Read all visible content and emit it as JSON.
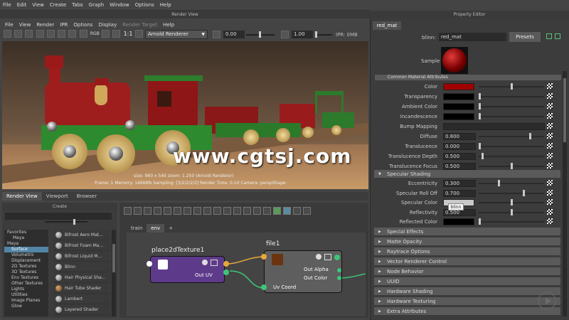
{
  "main_menu": [
    "File",
    "Edit",
    "View",
    "Create",
    "Tabs",
    "Graph",
    "Window",
    "Options",
    "Help"
  ],
  "render_view": {
    "title": "Render View",
    "menu": [
      "File",
      "View",
      "Render",
      "IPR",
      "Options",
      "Display",
      "Render Target",
      "Help"
    ],
    "renderer": "Arnold Renderer",
    "exposure": "0.00",
    "gamma": "1.00",
    "ipr": "IPR: 0MB",
    "ratio": "1:1",
    "mode": "RGB",
    "watermark": "www.cgtsj.com",
    "status_line1": "size: 960 x 540  zoom: 1.250     (Arnold Renderer)",
    "status_line2": "Frame: 1   Memory: 1466Mb   Sampling: [3/2/2/2/2]   Render Time: 0:10   Camera: perspShape"
  },
  "bottom_tabs": [
    "Render View",
    "Viewport",
    "Browser"
  ],
  "create_panel": {
    "title": "Create",
    "tree": [
      "Favorites",
      "Maya",
      "Maya",
      "Surface",
      "Volumetric",
      "Displacement",
      "2D Textures",
      "3D Textures",
      "Env Textures",
      "Other Textures",
      "Lights",
      "Utilities",
      "Image Planes",
      "Glow"
    ],
    "selected": "Surface",
    "shaders": [
      "Bifrost Aero Mat...",
      "Bifrost Foam Ma...",
      "Bifrost Liquid M...",
      "Blinn",
      "Hair Physical Sha...",
      "Hair Tube Shader",
      "Lambert",
      "Layered Shader"
    ]
  },
  "node_editor": {
    "tabs": [
      "train",
      "env",
      "+"
    ],
    "node1": {
      "title": "place2dTexture1",
      "port": "Out UV"
    },
    "node2": {
      "title": "file1",
      "ports": [
        "Out Alpha",
        "Out Color",
        "Uv Coord"
      ]
    }
  },
  "property_editor": {
    "title": "Property Editor",
    "tab": "red_mat",
    "type_label": "blinn:",
    "name": "red_mat",
    "presets": "Presets",
    "sample": "Sample",
    "common_section": "Common Material Attributes",
    "rows": [
      {
        "label": "Color",
        "kind": "color",
        "color": "#a00000",
        "knob": 0.5
      },
      {
        "label": "Transparency",
        "kind": "color",
        "color": "#000000",
        "knob": 0.0
      },
      {
        "label": "Ambient Color",
        "kind": "color",
        "color": "#000000",
        "knob": 0.0
      },
      {
        "label": "Incandescence",
        "kind": "color",
        "color": "#000000",
        "knob": 0.0
      },
      {
        "label": "Bump Mapping",
        "kind": "empty"
      },
      {
        "label": "Diffuse",
        "kind": "value",
        "value": "0.800",
        "knob": 0.8
      },
      {
        "label": "Translucence",
        "kind": "value",
        "value": "0.000",
        "knob": 0.0
      },
      {
        "label": "Translucence Depth",
        "kind": "value",
        "value": "0.500",
        "knob": 0.05
      },
      {
        "label": "Translucence Focus",
        "kind": "value",
        "value": "0.500",
        "knob": 0.5
      }
    ],
    "specular_section": "Specular Shading",
    "spec_rows": [
      {
        "label": "Eccentricity",
        "kind": "value",
        "value": "0.300",
        "knob": 0.3
      },
      {
        "label": "Specular Roll Off",
        "kind": "value",
        "value": "0.700",
        "knob": 0.7
      },
      {
        "label": "Specular Color",
        "kind": "color",
        "color": "#c8c8c8",
        "knob": 0.5
      },
      {
        "label": "Reflectivity",
        "kind": "value",
        "value": "0.500",
        "knob": 0.5
      },
      {
        "label": "Reflected Color",
        "kind": "color",
        "color": "#000000",
        "knob": 0.0
      }
    ],
    "tooltip": "blinn",
    "collapsed_sections": [
      "Special Effects",
      "Matte Opacity",
      "Raytrace Options",
      "Vector Renderer Control",
      "Node Behavior",
      "UUID",
      "Hardware Shading",
      "Hardware Texturing",
      "Extra Attributes"
    ]
  }
}
